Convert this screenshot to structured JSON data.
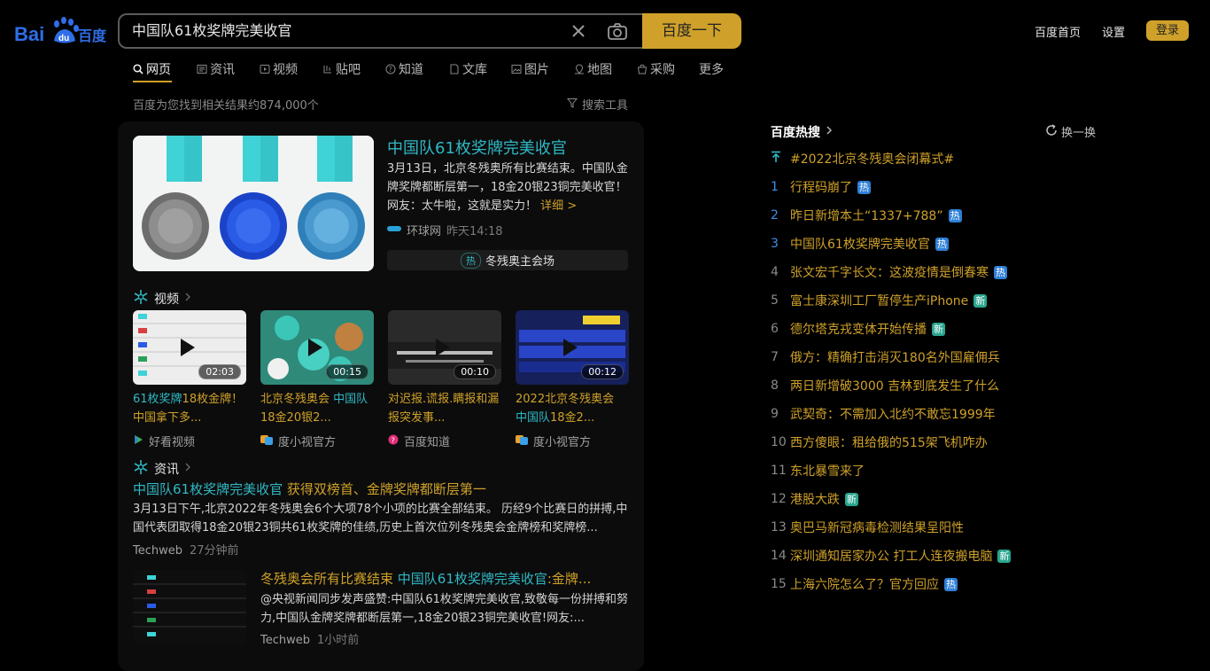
{
  "header": {
    "logo_text": "Bai百度",
    "search_value": "中国队61枚奖牌完美收官",
    "search_button": "百度一下",
    "links": [
      "百度首页",
      "设置"
    ],
    "login": "登录"
  },
  "tabs": [
    {
      "label": "网页",
      "icon": "search-icon",
      "active": true
    },
    {
      "label": "资讯",
      "icon": "news-icon"
    },
    {
      "label": "视频",
      "icon": "video-icon"
    },
    {
      "label": "贴吧",
      "icon": "tieba-icon"
    },
    {
      "label": "知道",
      "icon": "question-icon"
    },
    {
      "label": "文库",
      "icon": "doc-icon"
    },
    {
      "label": "图片",
      "icon": "image-icon"
    },
    {
      "label": "地图",
      "icon": "map-icon"
    },
    {
      "label": "采购",
      "icon": "shop-icon"
    },
    {
      "label": "更多"
    }
  ],
  "result_count": "百度为您找到相关结果约874,000个",
  "search_tools": "搜索工具",
  "top_result": {
    "title": "中国队61枚奖牌完美收官",
    "desc": "3月13日，北京冬残奥所有比赛结束。中国队金牌奖牌都断层第一，18金20银23铜完美收官！网友：太牛啦，这就是实力！",
    "more": "详细 >",
    "source": "环球网",
    "time": "昨天14:18",
    "hot_tag": "热",
    "hot_label": "冬残奥主会场"
  },
  "video_section": {
    "title": "视频",
    "videos": [
      {
        "duration": "02:03",
        "title_hl": "61枚奖牌",
        "title_rest": "18枚金牌！中国拿下多...",
        "source": "好看视频"
      },
      {
        "duration": "00:15",
        "title_pre": "北京冬残奥会 ",
        "title_hl": "中国队",
        "title_rest": "18金20银2...",
        "source": "度小视官方"
      },
      {
        "duration": "00:10",
        "title_pre": "对迟报.谎报.瞒报和漏报突发事...",
        "source": "百度知道"
      },
      {
        "duration": "00:12",
        "title_pre": "2022北京冬残奥会 ",
        "title_hl": "中国队",
        "title_rest": "18金2...",
        "source": "度小视官方"
      }
    ]
  },
  "news_section": {
    "title": "资讯",
    "item1": {
      "title_hl": "中国队61枚奖牌完美收官",
      "title_rest": " 获得双榜首、金牌奖牌都断层第一",
      "desc": "3月13日下午,北京2022年冬残奥会6个大项78个小项的比赛全部结束。 历经9个比赛日的拼搏,中国代表团取得18金20银23铜共61枚奖牌的佳绩,历史上首次位列冬残奥会金牌榜和奖牌榜...",
      "source": "Techweb",
      "time": "27分钟前"
    },
    "item2": {
      "title_pre": "冬残奥会所有比赛结束 ",
      "title_hl": "中国队61枚奖牌完美收官",
      "title_rest": ":金牌...",
      "desc": "@央视新闻同步发声盛赞:中国队61枚奖牌完美收官,致敬每一份拼搏和努力,中国队金牌奖牌都断层第一,18金20银23铜完美收官!网友:...",
      "source": "Techweb",
      "time": "1小时前"
    }
  },
  "hot_list": {
    "title": "百度热搜",
    "refresh": "换一换",
    "items": [
      {
        "num": "",
        "text": "#2022北京冬残奥会闭幕式#",
        "badge": ""
      },
      {
        "num": "1",
        "text": "行程码崩了",
        "badge": "热"
      },
      {
        "num": "2",
        "text": "昨日新增本土“1337+788”",
        "badge": "热"
      },
      {
        "num": "3",
        "text": "中国队61枚奖牌完美收官",
        "badge": "热"
      },
      {
        "num": "4",
        "text": "张文宏千字长文：这波疫情是倒春寒",
        "badge": "热"
      },
      {
        "num": "5",
        "text": "富士康深圳工厂暂停生产iPhone",
        "badge": "新"
      },
      {
        "num": "6",
        "text": "德尔塔克戎变体开始传播",
        "badge": "新"
      },
      {
        "num": "7",
        "text": "俄方：精确打击消灭180名外国雇佣兵",
        "badge": ""
      },
      {
        "num": "8",
        "text": "两日新增破3000 吉林到底发生了什么",
        "badge": ""
      },
      {
        "num": "9",
        "text": "武契奇：不需加入北约不敢忘1999年",
        "badge": ""
      },
      {
        "num": "10",
        "text": "西方傻眼：租给俄的515架飞机咋办",
        "badge": ""
      },
      {
        "num": "11",
        "text": "东北暴雪来了",
        "badge": ""
      },
      {
        "num": "12",
        "text": "港股大跌",
        "badge": "新"
      },
      {
        "num": "13",
        "text": "奥巴马新冠病毒检测结果呈阳性",
        "badge": ""
      },
      {
        "num": "14",
        "text": "深圳通知居家办公 打工人连夜搬电脑",
        "badge": "新"
      },
      {
        "num": "15",
        "text": "上海六院怎么了？官方回应",
        "badge": "热"
      }
    ]
  },
  "colors": {
    "accent": "#cfa12a",
    "link": "#2fb8c4",
    "hot_badge": "#2e7fd6",
    "new_badge": "#2aa58e"
  }
}
